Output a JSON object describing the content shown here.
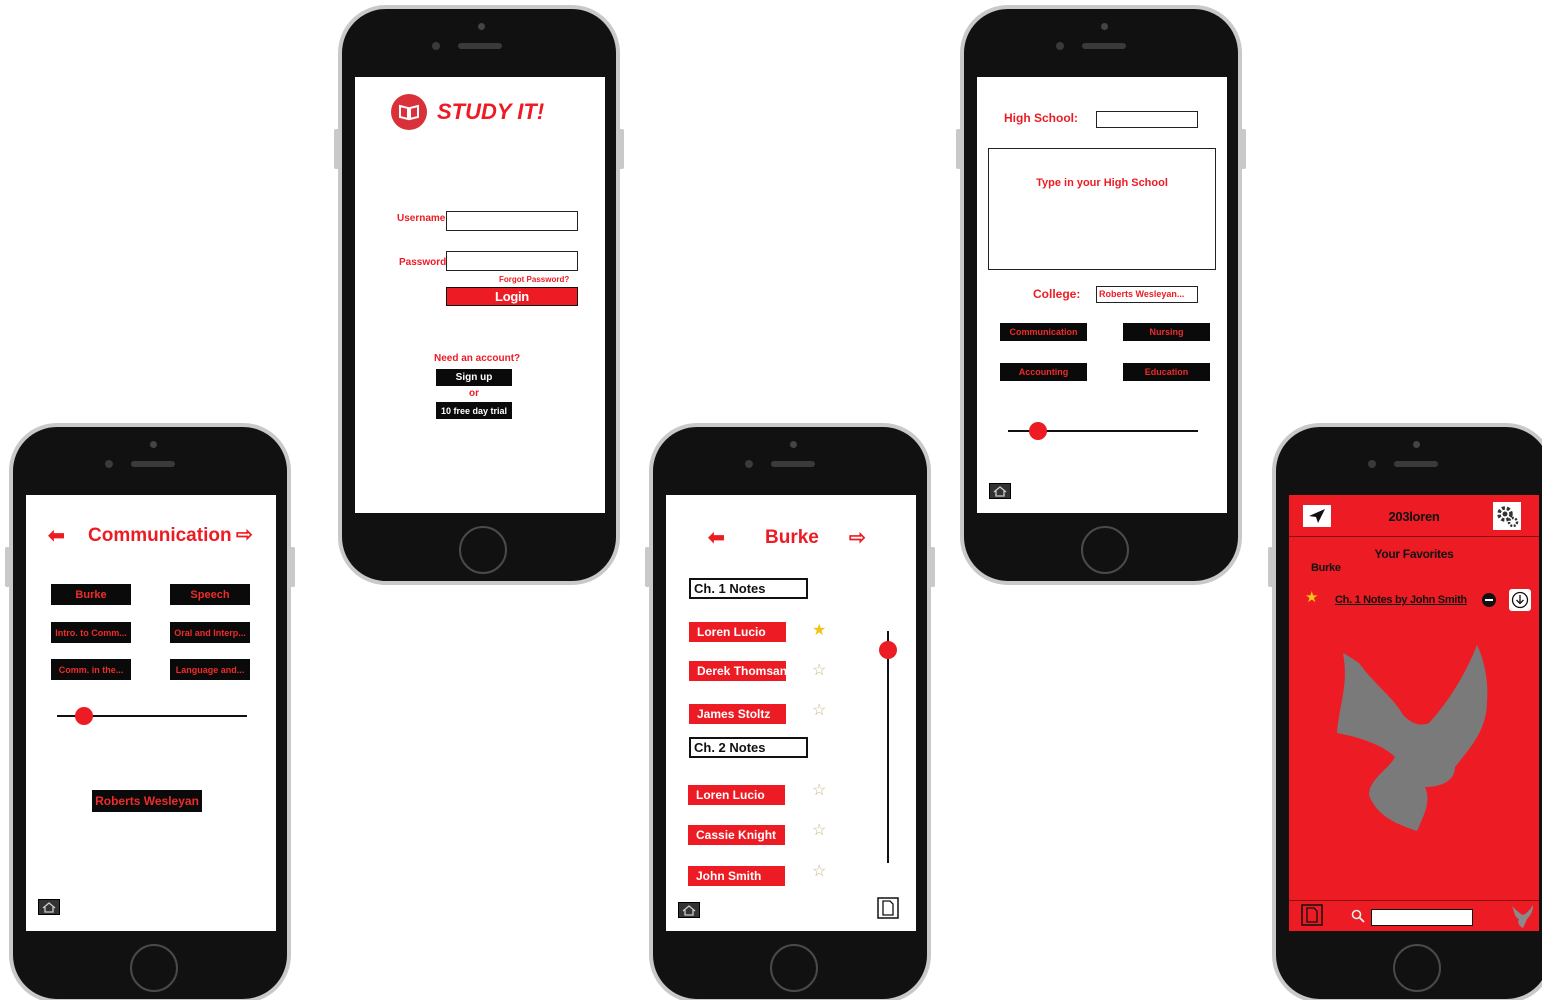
{
  "login": {
    "logo_text": "STUDY IT!",
    "username_label": "Username",
    "password_label": "Password",
    "forgot_label": "Forgot Password?",
    "login_label": "Login",
    "need_account": "Need an account?",
    "signup_label": "Sign up",
    "or_label": "or",
    "trial_label": "10 free day trial"
  },
  "school": {
    "hs_label": "High School:",
    "hs_hint": "Type in your High School",
    "college_label": "College:",
    "college_value": "Roberts Wesleyan...",
    "majors": [
      "Communication",
      "Nursing",
      "Accounting",
      "Education"
    ],
    "slider_level": 0.15
  },
  "comm": {
    "title": "Communication",
    "courses": [
      "Burke",
      "Speech",
      "Intro. to Comm...",
      "Oral and Interp...",
      "Comm. in the...",
      "Language and..."
    ],
    "slider_level": 0.15,
    "school_label": "Roberts Wesleyan"
  },
  "burke": {
    "title": "Burke",
    "sections": [
      {
        "label": "Ch. 1 Notes",
        "authors": [
          {
            "name": "Loren Lucio",
            "fav": true
          },
          {
            "name": "Derek Thomsan",
            "fav": false
          },
          {
            "name": "James Stoltz",
            "fav": false
          }
        ]
      },
      {
        "label": "Ch. 2 Notes",
        "authors": [
          {
            "name": "Loren Lucio",
            "fav": false
          },
          {
            "name": "Cassie Knight",
            "fav": false
          },
          {
            "name": "John Smith",
            "fav": false
          }
        ]
      }
    ],
    "scroll_level": 0.09
  },
  "profile": {
    "username": "203loren",
    "favorites_title": "Your Favorites",
    "course": "Burke",
    "favorite_item": "Ch. 1 Notes by John Smith",
    "search_placeholder": ""
  },
  "colors": {
    "brand_red": "#ed1c24",
    "black": "#0a0a0a",
    "mascot_gray": "#7a7a7a"
  }
}
